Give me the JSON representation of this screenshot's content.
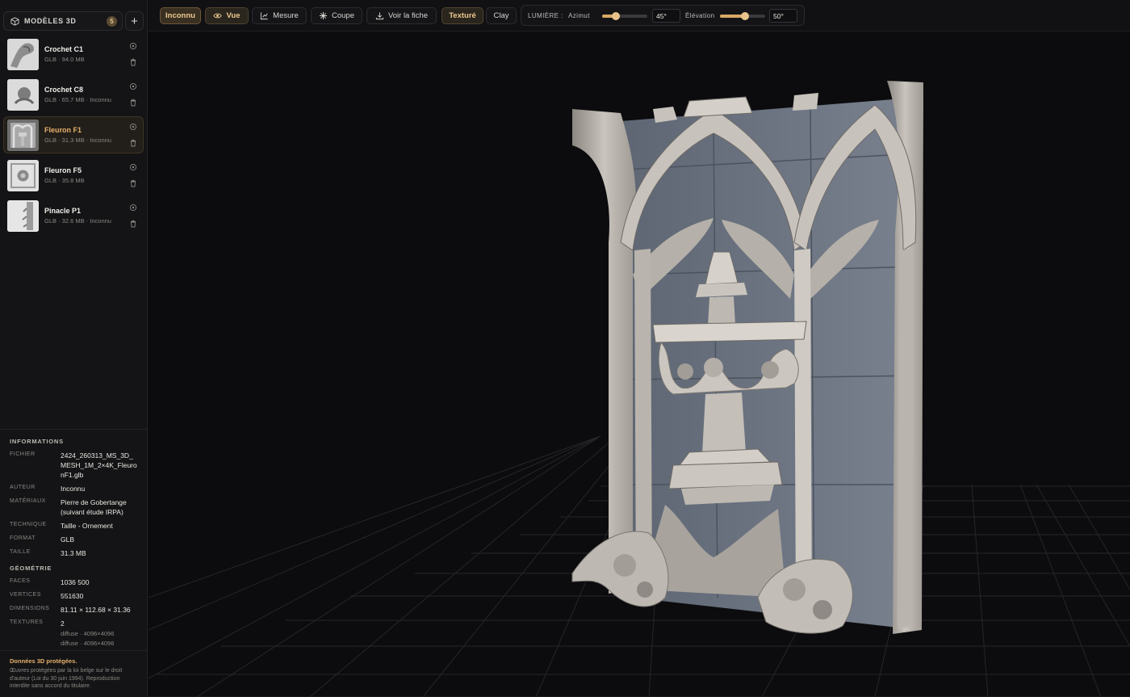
{
  "sidebar": {
    "title": "MODÈLES 3D",
    "count": "5",
    "add_label": "+",
    "models": [
      {
        "name": "Crochet C1",
        "meta": "GLB · 94.0 MB"
      },
      {
        "name": "Crochet C8",
        "meta": "GLB · 65.7 MB · Inconnu"
      },
      {
        "name": "Fleuron F1",
        "meta": "GLB · 31.3 MB · Inconnu"
      },
      {
        "name": "Fleuron F5",
        "meta": "GLB · 35.8 MB"
      },
      {
        "name": "Pinacle P1",
        "meta": "GLB · 32.6 MB · Inconnu"
      }
    ],
    "active_model": "Fleuron F1"
  },
  "info": {
    "heading": "INFORMATIONS",
    "fichier_key": "FICHIER",
    "fichier": "2424_260313_MS_3D_MESH_1M_2×4K_FleuronF1.glb",
    "auteur_key": "AUTEUR",
    "auteur": "Inconnu",
    "materiaux_key": "MATÉRIAUX",
    "materiaux": "Pierre de Gobertange (suivant étude IRPA)",
    "technique_key": "TECHNIQUE",
    "technique": "Taille - Ornement",
    "format_key": "FORMAT",
    "format": "GLB",
    "taille_key": "TAILLE",
    "taille": "31.3 MB"
  },
  "geometry": {
    "heading": "GÉOMÉTRIE",
    "faces_key": "FACES",
    "faces": "1036 500",
    "vertices_key": "VERTICES",
    "vertices": "551630",
    "dimensions_key": "DIMENSIONS",
    "dimensions": "81.11 × 112.68 × 31.36",
    "textures_key": "TEXTURES",
    "textures": "2",
    "texture_list": [
      "diffuse · 4096×4096",
      "diffuse · 4096×4096"
    ]
  },
  "notice": {
    "title": "Données 3D protégées.",
    "text": "Œuvres protégées par la loi belge sur le droit d'auteur (Loi du 30 juin 1994). Reproduction interdite sans accord du titulaire."
  },
  "toolbar": {
    "author_label": "Inconnu",
    "view_label": "Vue",
    "measure_label": "Mesure",
    "section_label": "Coupe",
    "sheet_label": "Voir la fiche",
    "textured_label": "Texturé",
    "clay_label": "Clay",
    "light_label": "LUMIÈRE :",
    "azimuth_label": "Azimut",
    "azimuth_value": "45°",
    "azimuth_level": 0.3,
    "elevation_label": "Élévation",
    "elevation_value": "50°",
    "elevation_level": 0.55
  },
  "icons": [
    "cube-icon",
    "eye-icon",
    "trash-icon",
    "ruler-icon",
    "section-icon",
    "download-icon"
  ],
  "colors": {
    "accent": "#e6b06a",
    "background": "#0d0d0f",
    "panel": "#141416"
  }
}
